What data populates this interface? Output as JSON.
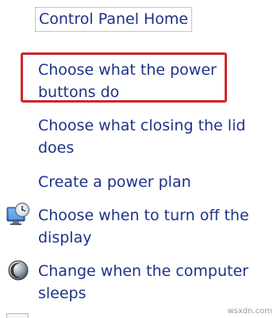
{
  "panel": {
    "home_link": "Control Panel Home",
    "links": [
      {
        "line1": "Choose what the power",
        "line2": "buttons do",
        "icon": null,
        "highlighted": true
      },
      {
        "line1": "Choose what closing the lid",
        "line2": "does",
        "icon": null
      },
      {
        "line1": "Create a power plan",
        "line2": null,
        "icon": null
      },
      {
        "line1": "Choose when to turn off the",
        "line2": "display",
        "icon": "display-clock-icon"
      },
      {
        "line1": "Change when the computer",
        "line2": "sleeps",
        "icon": "sleep-moon-icon"
      }
    ]
  },
  "watermark": "wsxdn.com",
  "colors": {
    "link": "#1e3287",
    "highlight": "#d2232a"
  }
}
